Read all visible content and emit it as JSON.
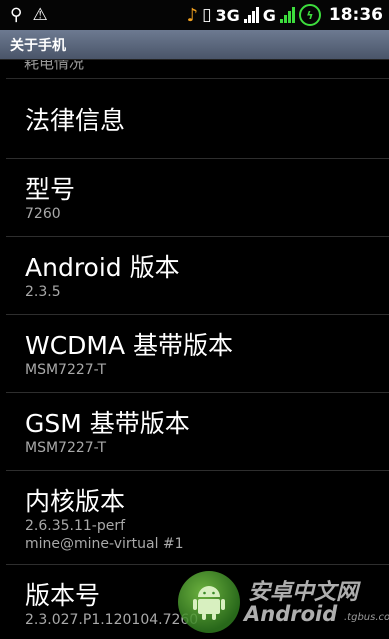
{
  "status_bar": {
    "icons": [
      "usb-icon",
      "warning-icon",
      "music-note-icon",
      "vibrate-icon",
      "wifi-icon",
      "battery-charging-icon"
    ],
    "network_1": "3G",
    "network_2": "G",
    "time": "18:36",
    "accent_green": "#3ddc3d",
    "accent_orange": "#f0a020"
  },
  "title_bar": {
    "title": "关于手机",
    "color": "#5a6780"
  },
  "list": {
    "partial_item": "耗电情况",
    "items": [
      {
        "title": "法律信息"
      },
      {
        "title": "型号",
        "value": "7260"
      },
      {
        "title": "Android 版本",
        "value": "2.3.5"
      },
      {
        "title": "WCDMA 基带版本",
        "value": "MSM7227-T"
      },
      {
        "title": "GSM 基带版本",
        "value": "MSM7227-T"
      },
      {
        "title": "内核版本",
        "value": "2.6.35.11-perf",
        "value2": "mine@mine-virtual #1"
      },
      {
        "title": "版本号",
        "value": "2.3.027.P1.120104.7260"
      }
    ]
  },
  "watermark": {
    "site_cn": "安卓中文网",
    "site_en": "Android",
    "url": ".tgbus.com"
  }
}
